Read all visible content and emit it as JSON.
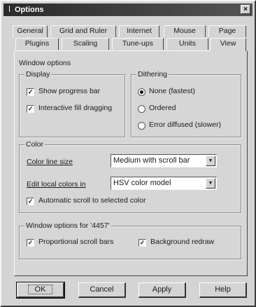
{
  "window": {
    "title": "Options",
    "close_glyph": "×"
  },
  "tabs_row1": [
    "General",
    "Grid and Ruler",
    "Internet",
    "Mouse",
    "Page"
  ],
  "tabs_row2": [
    "Plugins",
    "Scaling",
    "Tune-ups",
    "Units",
    "View"
  ],
  "active_tab": "View",
  "view": {
    "section_label": "Window options",
    "display": {
      "label": "Display",
      "show_progress_bar": {
        "label": "Show progress bar",
        "checked": true
      },
      "interactive_fill_dragging": {
        "label": "Interactive fill dragging",
        "checked": true
      }
    },
    "dithering": {
      "label": "Dithering",
      "options": [
        "None (fastest)",
        "Ordered",
        "Error diffused (slower)"
      ],
      "selected": "None (fastest)"
    },
    "color": {
      "label": "Color",
      "color_line_size_label": "Color line size",
      "color_line_size_value": "Medium with scroll bar",
      "edit_local_colors_label": "Edit local colors in",
      "edit_local_colors_value": "HSV color model",
      "auto_scroll": {
        "label": "Automatic scroll to selected color",
        "checked": true
      }
    },
    "window_options_for": {
      "label": "Window options for '4457'",
      "proportional_scroll_bars": {
        "label": "Proportional scroll bars",
        "checked": true
      },
      "background_redraw": {
        "label": "Background redraw",
        "checked": true
      }
    }
  },
  "buttons": {
    "ok": "OK",
    "cancel": "Cancel",
    "apply": "Apply",
    "help": "Help"
  },
  "glyphs": {
    "check": "✓",
    "dropdown_arrow": "▼"
  }
}
